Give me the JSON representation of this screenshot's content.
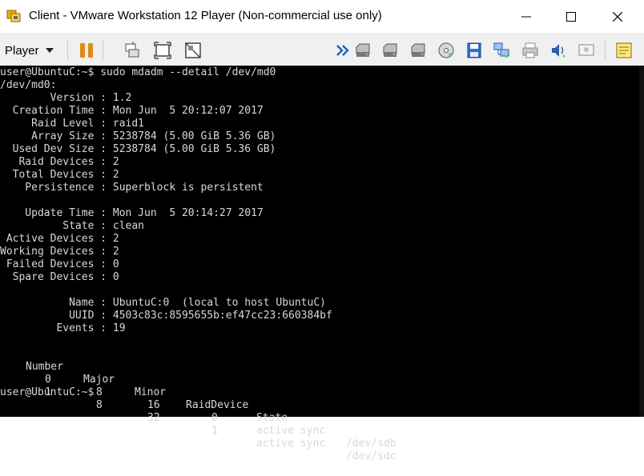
{
  "window": {
    "title": "Client - VMware Workstation 12 Player (Non-commercial use only)",
    "minimize_symbol": "—",
    "close_symbol": "✕"
  },
  "toolbar": {
    "player_label": "Player",
    "icons": [
      "pause-icon",
      "send-ctrl-alt-del-icon",
      "fit-guest-icon",
      "unity-icon",
      "more-devices-icon",
      "hard-disk-icon",
      "hard-disk-2-icon",
      "hard-disk-3-icon",
      "cd-dvd-icon",
      "floppy-icon",
      "network-adapter-icon",
      "printer-icon",
      "sound-card-icon",
      "display-icon",
      "message-log-icon"
    ]
  },
  "terminal": {
    "prompt_command": "user@UbuntuC:~$ sudo mdadm --detail /dev/md0",
    "device": "/dev/md0:",
    "details_1": [
      "        Version : 1.2",
      "  Creation Time : Mon Jun  5 20:12:07 2017",
      "     Raid Level : raid1",
      "     Array Size : 5238784 (5.00 GiB 5.36 GB)",
      "  Used Dev Size : 5238784 (5.00 GiB 5.36 GB)",
      "   Raid Devices : 2",
      "  Total Devices : 2",
      "    Persistence : Superblock is persistent"
    ],
    "details_2": [
      "    Update Time : Mon Jun  5 20:14:27 2017",
      "          State : clean",
      " Active Devices : 2",
      "Working Devices : 2",
      " Failed Devices : 0",
      "  Spare Devices : 0"
    ],
    "details_3": [
      "           Name : UbuntuC:0  (local to host UbuntuC)",
      "           UUID : 4503c83c:8595655b:ef47cc23:660384bf",
      "         Events : 19"
    ],
    "table": {
      "headers": [
        "Number",
        "Major",
        "Minor",
        "RaidDevice",
        "State"
      ],
      "rows": [
        {
          "number": "0",
          "major": "8",
          "minor": "16",
          "raid_device": "0",
          "state": "active sync",
          "device": "/dev/sdb"
        },
        {
          "number": "1",
          "major": "8",
          "minor": "32",
          "raid_device": "1",
          "state": "active sync",
          "device": "/dev/sdc"
        }
      ]
    },
    "final_prompt": "user@UbuntuC:~$"
  }
}
